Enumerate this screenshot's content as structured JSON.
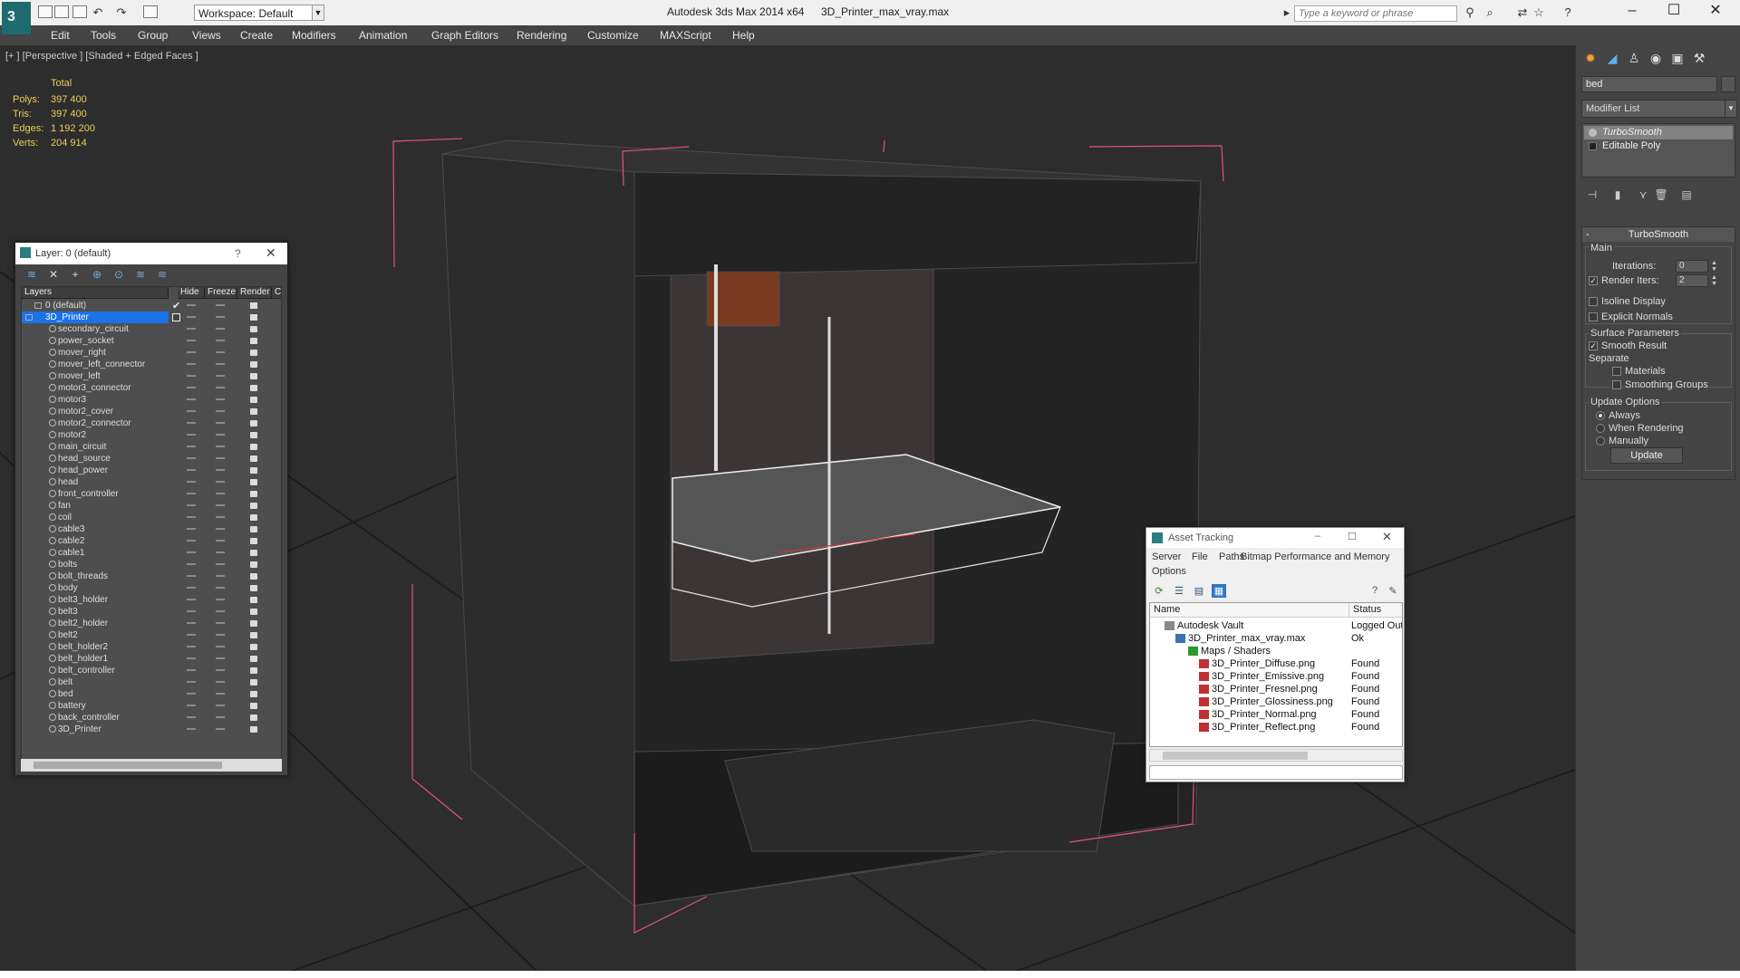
{
  "titlebar": {
    "workspace": "Workspace: Default",
    "app_title": "Autodesk 3ds Max  2014 x64",
    "file_title": "3D_Printer_max_vray.max",
    "search_placeholder": "Type a keyword or phrase"
  },
  "menu": [
    "Edit",
    "Tools",
    "Group",
    "Views",
    "Create",
    "Modifiers",
    "Animation",
    "Graph Editors",
    "Rendering",
    "Customize",
    "MAXScript",
    "Help"
  ],
  "viewport": {
    "label": "[+ ] [Perspective ] [Shaded + Edged Faces ]",
    "stats": {
      "total_label": "Total",
      "rows": [
        {
          "label": "Polys:",
          "value": "397 400"
        },
        {
          "label": "Tris:",
          "value": "397 400"
        },
        {
          "label": "Edges:",
          "value": "1 192 200"
        },
        {
          "label": "Verts:",
          "value": "204 914"
        }
      ]
    }
  },
  "command_panel": {
    "object_name": "bed",
    "modifier_list": "Modifier List",
    "stack": [
      "TurboSmooth",
      "Editable Poly"
    ],
    "turbosmooth": {
      "title": "TurboSmooth",
      "main": "Main",
      "iterations_label": "Iterations:",
      "iterations_value": "0",
      "render_iters_label": "Render Iters:",
      "render_iters_value": "2",
      "isoline": "Isoline Display",
      "explicit_normals": "Explicit Normals",
      "surface_params": "Surface Parameters",
      "smooth_result": "Smooth Result",
      "separate": "Separate",
      "materials": "Materials",
      "smoothing_groups": "Smoothing Groups",
      "update_options": "Update Options",
      "always": "Always",
      "when_rendering": "When Rendering",
      "manually": "Manually",
      "update_button": "Update"
    }
  },
  "layer_window": {
    "title": "Layer: 0 (default)",
    "help": "?",
    "columns": [
      "Layers",
      "Hide",
      "Freeze",
      "Render",
      "C"
    ],
    "root_layers": [
      "0 (default)",
      "3D_Printer"
    ],
    "objects": [
      "secondary_circuit",
      "power_socket",
      "mover_right",
      "mover_left_connector",
      "mover_left",
      "motor3_connector",
      "motor3",
      "motor2_cover",
      "motor2_connector",
      "motor2",
      "main_circuit",
      "head_source",
      "head_power",
      "head",
      "front_controller",
      "fan",
      "coil",
      "cable3",
      "cable2",
      "cable1",
      "bolts",
      "bolt_threads",
      "body",
      "belt3_holder",
      "belt3",
      "belt2_holder",
      "belt2",
      "belt_holder2",
      "belt_holder1",
      "belt_controller",
      "belt",
      "bed",
      "battery",
      "back_controller",
      "3D_Printer"
    ]
  },
  "asset_window": {
    "title": "Asset Tracking",
    "menu": [
      "Server",
      "File",
      "Paths",
      "Bitmap Performance and Memory",
      "Options"
    ],
    "columns": [
      "Name",
      "Status"
    ],
    "rows": [
      {
        "name": "Autodesk Vault",
        "status": "Logged Out"
      },
      {
        "name": "3D_Printer_max_vray.max",
        "status": "Ok"
      },
      {
        "name": "Maps / Shaders",
        "status": ""
      },
      {
        "name": "3D_Printer_Diffuse.png",
        "status": "Found"
      },
      {
        "name": "3D_Printer_Emissive.png",
        "status": "Found"
      },
      {
        "name": "3D_Printer_Fresnel.png",
        "status": "Found"
      },
      {
        "name": "3D_Printer_Glossiness.png",
        "status": "Found"
      },
      {
        "name": "3D_Printer_Normal.png",
        "status": "Found"
      },
      {
        "name": "3D_Printer_Reflect.png",
        "status": "Found"
      }
    ]
  },
  "colors": {
    "stats_yellow": "#e8d058",
    "selection_blue": "#1a73e8",
    "bbox_pink": "#e0508a"
  }
}
